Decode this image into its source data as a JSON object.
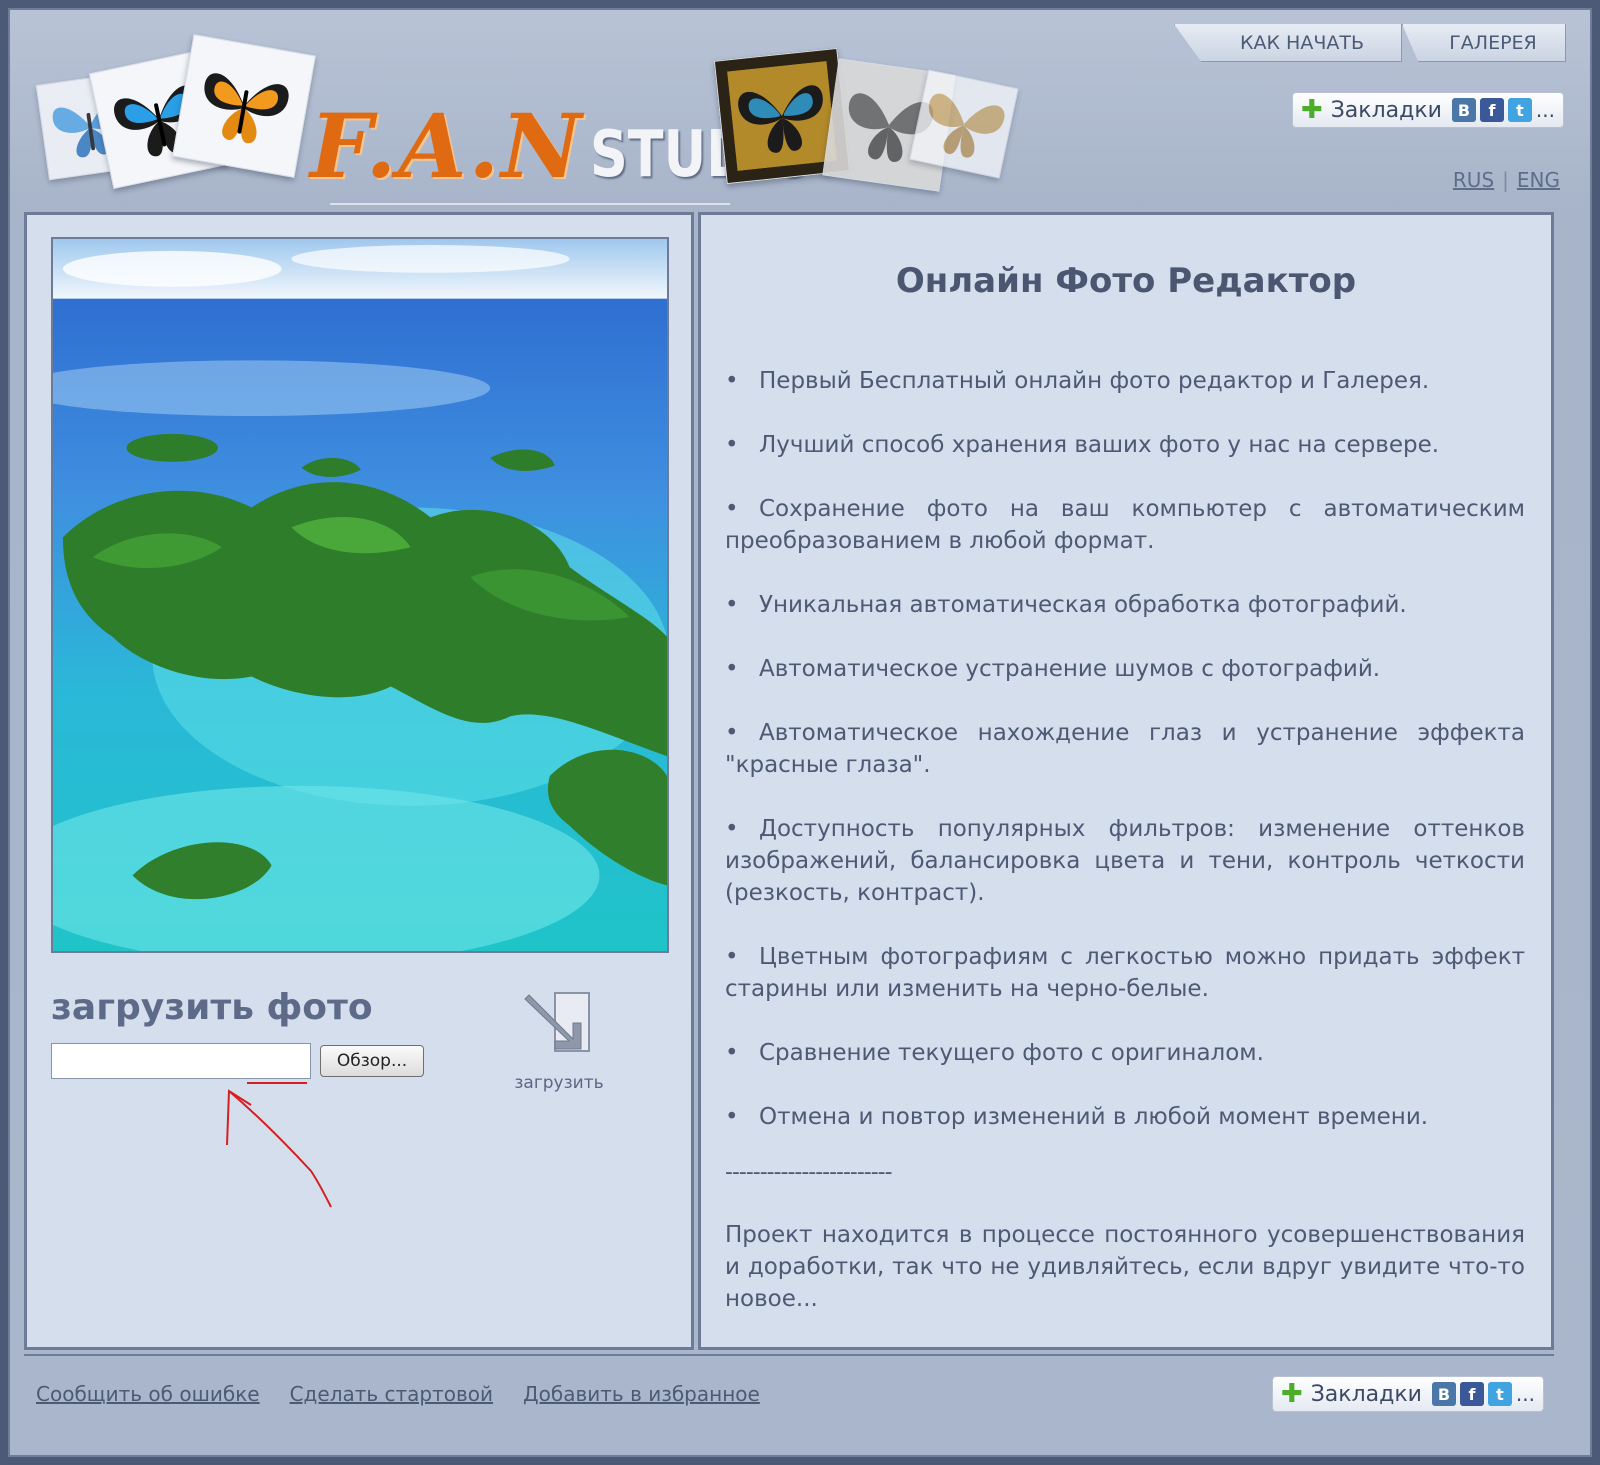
{
  "header": {
    "logo_fan": "F.A.N",
    "logo_studio": "STUDIO",
    "nav": [
      {
        "label": "КАК НАЧАТЬ"
      },
      {
        "label": "ГАЛЕРЕЯ"
      }
    ],
    "bookmarks_label": "Закладки",
    "bookmarks_vk": "B",
    "bookmarks_fb": "f",
    "bookmarks_tw": "t",
    "bookmarks_more": "...",
    "lang": {
      "rus": "RUS",
      "separator": "|",
      "eng": "ENG"
    }
  },
  "upload": {
    "title": "загрузить фото",
    "file_value": "",
    "browse_label": "Обзор...",
    "action_label": "загрузить"
  },
  "editor": {
    "title": "Онлайн Фото Редактор",
    "bullet": "•",
    "features": [
      "Первый Бесплатный онлайн фото редактор и Галерея.",
      "Лучший способ хранения ваших фото у нас на сервере.",
      "Сохранение фото на ваш компьютер с автоматическим преобразованием в любой формат.",
      "Уникальная автоматическая обработка фотографий.",
      "Автоматическое устранение шумов с фотографий.",
      "Автоматическое нахождение глаз и устранение эффекта \"красные глаза\".",
      "Доступность популярных фильтров: изменение оттенков изображений, балансировка цвета и тени, контроль четкости (резкость, контраст).",
      "Цветным фотографиям с легкостью можно придать эффект старины или изменить на черно-белые.",
      "Сравнение текущего фото с оригиналом.",
      "Отмена и повтор изменений в любой момент времени."
    ],
    "divider": "------------------------",
    "note": "Проект находится в процессе постоянного усовершенствования и доработки, так что не удивляйтесь, если вдруг увидите что-то новое..."
  },
  "footer": {
    "links": [
      {
        "label": "Сообщить об ошибке"
      },
      {
        "label": "Сделать стартовой"
      },
      {
        "label": "Добавить в избранное"
      }
    ]
  },
  "colors": {
    "background": "#4c5a78",
    "panel": "#d5deed",
    "accent_orange": "#e06a12",
    "annotation_red": "#d42020"
  },
  "icons": [
    "butterfly-icon",
    "plus-icon",
    "vk-icon",
    "facebook-icon",
    "twitter-icon",
    "upload-arrow-icon",
    "annotation-arrow-icon"
  ]
}
